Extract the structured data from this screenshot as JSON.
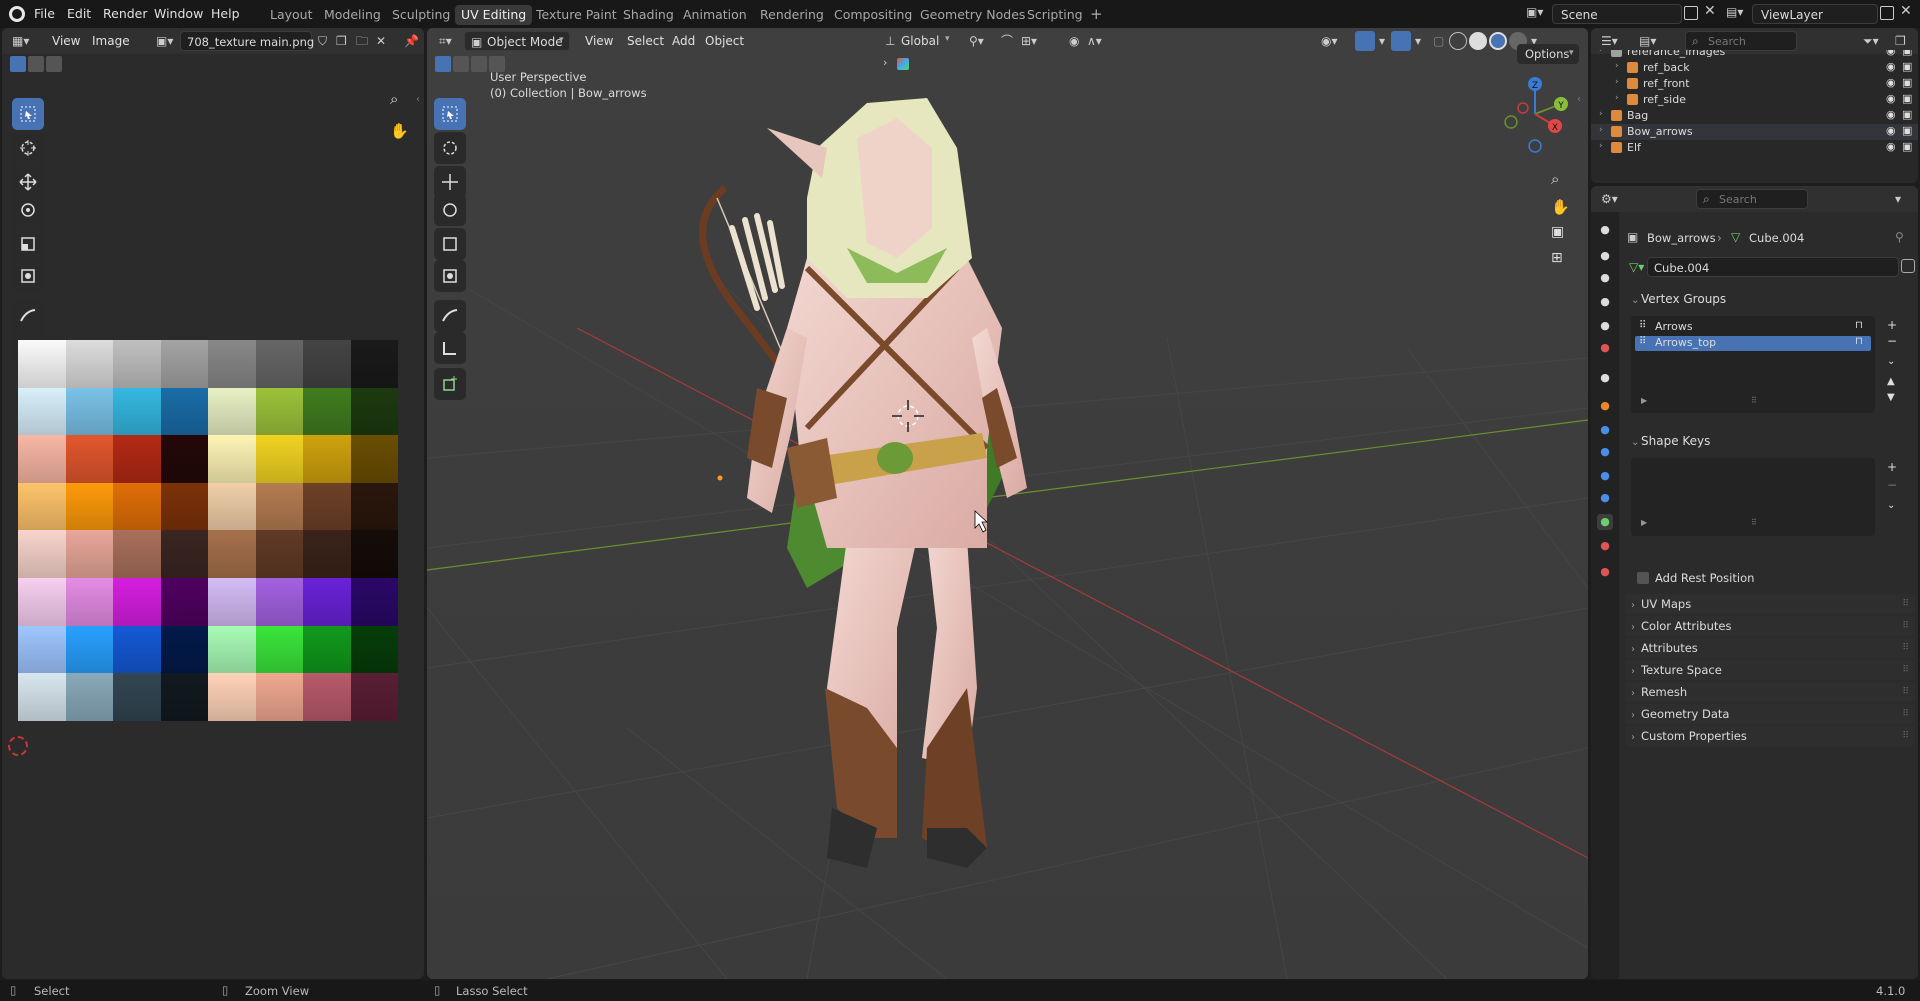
{
  "menu": {
    "file": "File",
    "edit": "Edit",
    "render": "Render",
    "window": "Window",
    "help": "Help"
  },
  "workspaces": [
    "Layout",
    "Modeling",
    "Sculpting",
    "UV Editing",
    "Texture Paint",
    "Shading",
    "Animation",
    "Rendering",
    "Compositing",
    "Geometry Nodes",
    "Scripting"
  ],
  "active_workspace": "UV Editing",
  "scene": "Scene",
  "view_layer": "ViewLayer",
  "image_editor": {
    "view": "View",
    "image": "Image",
    "image_name": "708_texture main.png"
  },
  "viewport": {
    "mode": "Object Mode",
    "view": "View",
    "select": "Select",
    "add": "Add",
    "object": "Object",
    "orientation": "Global",
    "options": "Options",
    "perspective": "User Perspective",
    "collection": "(0) Collection | Bow_arrows",
    "gizmo": {
      "x": "X",
      "y": "Y",
      "z": "Z"
    }
  },
  "outliner": {
    "search_placeholder": "Search",
    "items": [
      {
        "name": "referance_images"
      },
      {
        "name": "ref_back"
      },
      {
        "name": "ref_front"
      },
      {
        "name": "ref_side"
      },
      {
        "name": "Bag"
      },
      {
        "name": "Bow_arrows"
      },
      {
        "name": "Elf"
      }
    ]
  },
  "properties": {
    "search_placeholder": "Search",
    "breadcrumb_object": "Bow_arrows",
    "breadcrumb_mesh": "Cube.004",
    "mesh_name": "Cube.004",
    "vertex_groups_title": "Vertex Groups",
    "vertex_groups": [
      "Arrows",
      "Arrows_top"
    ],
    "shape_keys_title": "Shape Keys",
    "add_rest_position": "Add Rest Position",
    "panels": [
      "UV Maps",
      "Color Attributes",
      "Attributes",
      "Texture Space",
      "Remesh",
      "Geometry Data",
      "Custom Properties"
    ]
  },
  "status": {
    "select": "Select",
    "zoom": "Zoom View",
    "lasso": "Lasso Select",
    "version": "4.1.0"
  },
  "colors": {
    "accent": "#4772b3",
    "bg": "#303030",
    "viewport": "#3d3d3d",
    "x_axis": "#c83c3c",
    "y_axis": "#6a8f2e"
  }
}
